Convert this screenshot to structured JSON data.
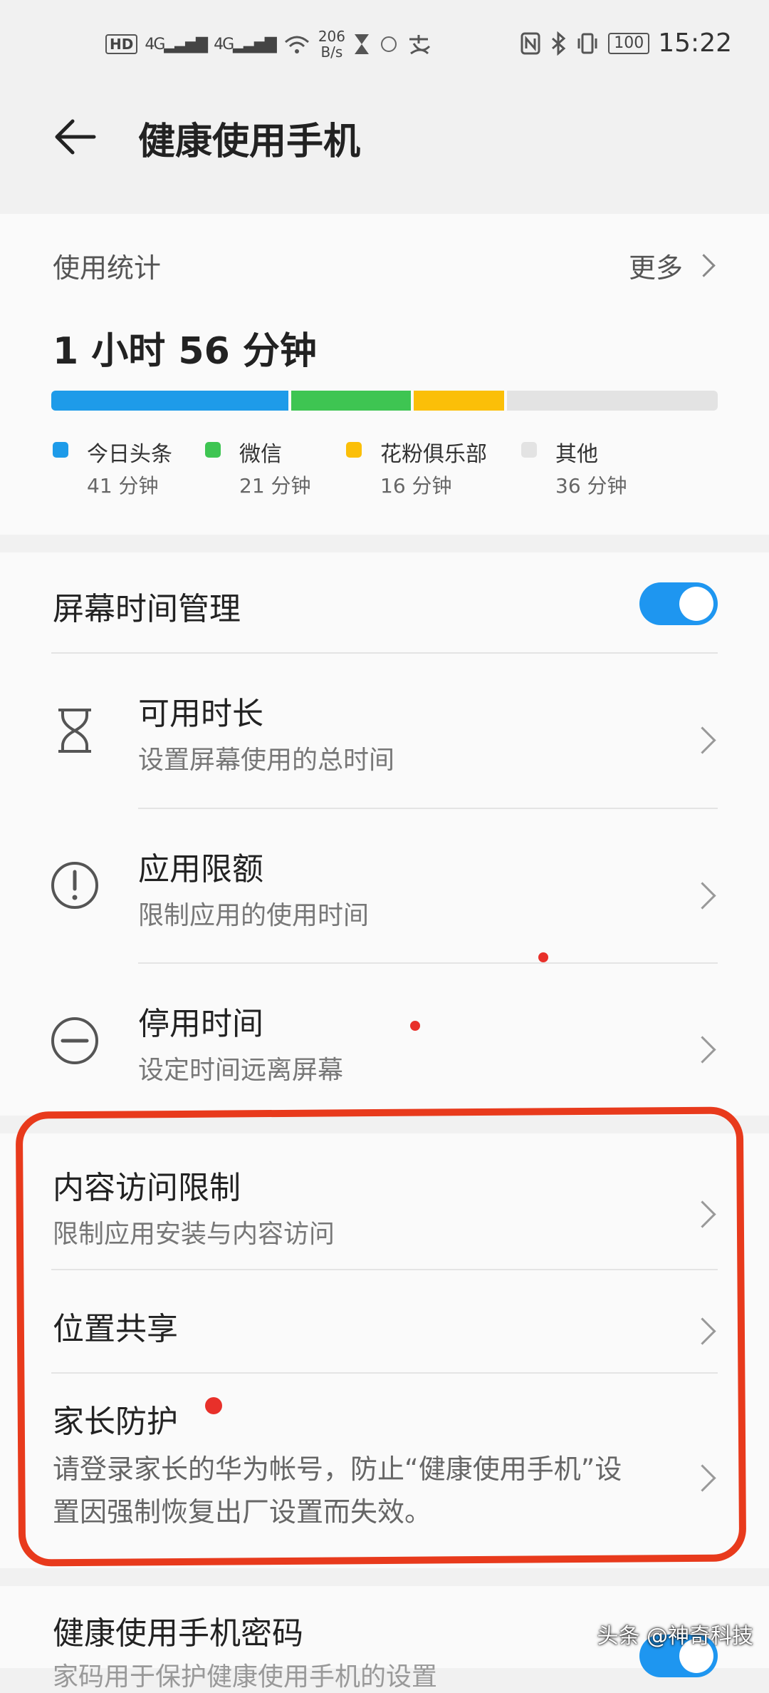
{
  "status_bar": {
    "hd": "HD",
    "net1": "4G",
    "net2": "4G",
    "speed_value": "206",
    "speed_unit": "B/s",
    "battery": "100",
    "time": "15:22"
  },
  "header": {
    "title": "健康使用手机"
  },
  "usage": {
    "title": "使用统计",
    "more_label": "更多",
    "total": "1 小时 56 分钟",
    "apps": [
      {
        "name": "今日头条",
        "duration": "41 分钟",
        "minutes": 41,
        "color": "#1e9be9"
      },
      {
        "name": "微信",
        "duration": "21 分钟",
        "minutes": 21,
        "color": "#3ec552"
      },
      {
        "name": "花粉俱乐部",
        "duration": "16 分钟",
        "minutes": 16,
        "color": "#fbbf08"
      },
      {
        "name": "其他",
        "duration": "36 分钟",
        "minutes": 36,
        "color": "#e3e3e3"
      }
    ]
  },
  "screen_time": {
    "title": "屏幕时间管理",
    "enabled": true,
    "items": [
      {
        "title": "可用时长",
        "subtitle": "设置屏幕使用的总时间",
        "icon": "hourglass-icon"
      },
      {
        "title": "应用限额",
        "subtitle": "限制应用的使用时间",
        "icon": "exclamation-circle-icon"
      },
      {
        "title": "停用时间",
        "subtitle": "设定时间远离屏幕",
        "icon": "minus-circle-icon"
      }
    ]
  },
  "restrictions": {
    "content": {
      "title": "内容访问限制",
      "subtitle": "限制应用安装与内容访问"
    },
    "location": {
      "title": "位置共享"
    },
    "parental": {
      "title": "家长防护",
      "line1": "请登录家长的华为帐号，防止“健康使用手机”设",
      "line2": "置因强制恢复出厂设置而失效。"
    }
  },
  "password": {
    "title": "健康使用手机密码",
    "subtitle": "家码用于保护健康使用手机的设置",
    "enabled": true
  },
  "watermark": "头条 @神奇科技",
  "colors": {
    "accent": "#1e96f0",
    "annotation": "#e83a1c"
  }
}
